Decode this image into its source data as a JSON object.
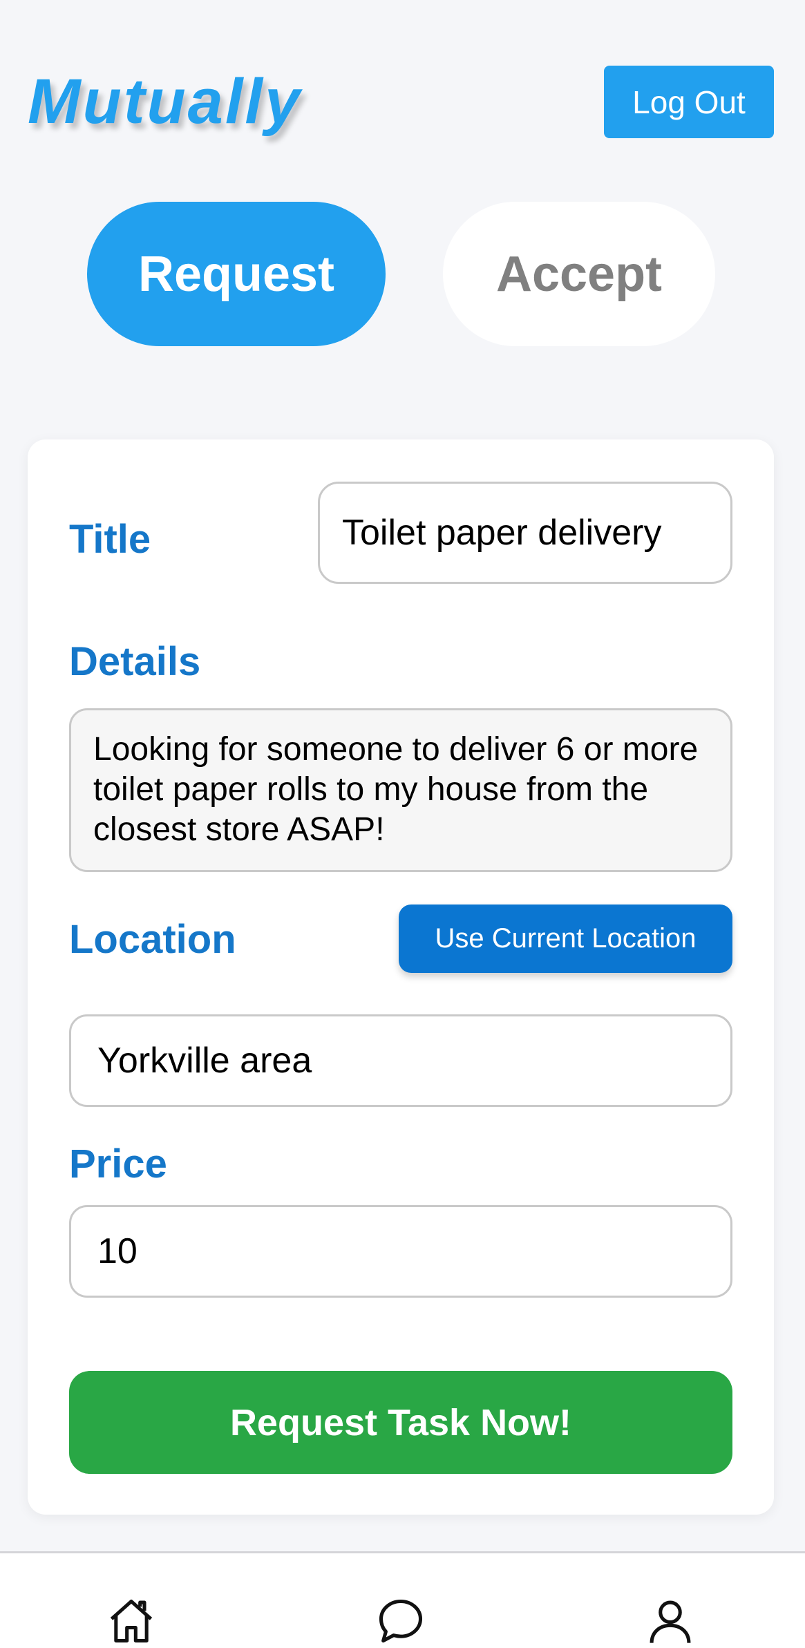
{
  "app": {
    "brand": "Mutually"
  },
  "header": {
    "logout_label": "Log Out"
  },
  "mode_tabs": {
    "request_label": "Request",
    "accept_label": "Accept"
  },
  "form": {
    "title_label": "Title",
    "title_value": "Toilet paper delivery",
    "details_label": "Details",
    "details_value": "Looking for someone to deliver 6 or more toilet paper rolls to my house from the closest store ASAP!",
    "location_label": "Location",
    "use_location_label": "Use Current Location",
    "location_value": "Yorkville area",
    "price_label": "Price",
    "price_value": "10",
    "submit_label": "Request Task Now!"
  },
  "tabbar": {
    "icons": [
      "home-icon",
      "chat-icon",
      "profile-icon"
    ]
  },
  "colors": {
    "primary": "#22a0ee",
    "label": "#1577c9",
    "location_button": "#0b76d1",
    "submit": "#29a745",
    "inactive_text": "#808080"
  }
}
